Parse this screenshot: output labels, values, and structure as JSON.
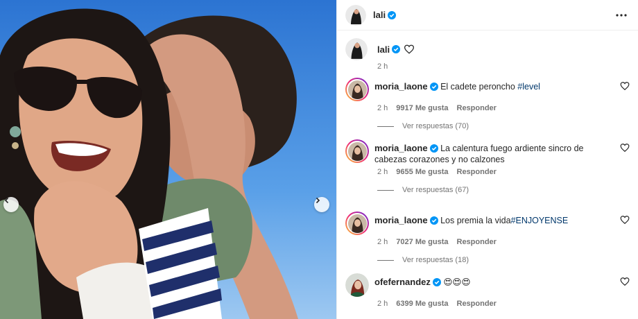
{
  "post": {
    "username": "lali",
    "caption_time": "2 h"
  },
  "comments": [
    {
      "username": "moria_laone",
      "text": "El cadete peroncho ",
      "tag": "#level",
      "time": "2 h",
      "likes": "9917 Me gusta",
      "reply_label": "Responder",
      "view_replies": "Ver respuestas (70)"
    },
    {
      "username": "moria_laone",
      "text": "La calentura fuego ardiente sincro de cabezas corazones y no calzones",
      "tag": "",
      "time": "2 h",
      "likes": "9655 Me gusta",
      "reply_label": "Responder",
      "view_replies": "Ver respuestas (67)"
    },
    {
      "username": "moria_laone",
      "text": "Los premia la vida",
      "tag": "#ENJOYENSE",
      "time": "2 h",
      "likes": "7027 Me gusta",
      "reply_label": "Responder",
      "view_replies": "Ver respuestas (18)"
    },
    {
      "username": "ofefernandez",
      "text": "😍😍😍",
      "tag": "",
      "time": "2 h",
      "likes": "6399 Me gusta",
      "reply_label": "Responder",
      "view_replies": ""
    }
  ],
  "icons": {
    "verified": "verified-badge-icon",
    "heart": "heart-outline-icon",
    "more": "more-horizontal-icon",
    "prev": "chevron-left-icon",
    "next": "chevron-right-icon"
  },
  "colors": {
    "verified_blue": "#0095f6",
    "link_blue": "#00376b",
    "muted_text": "#737373",
    "sky": "#3a86df"
  }
}
